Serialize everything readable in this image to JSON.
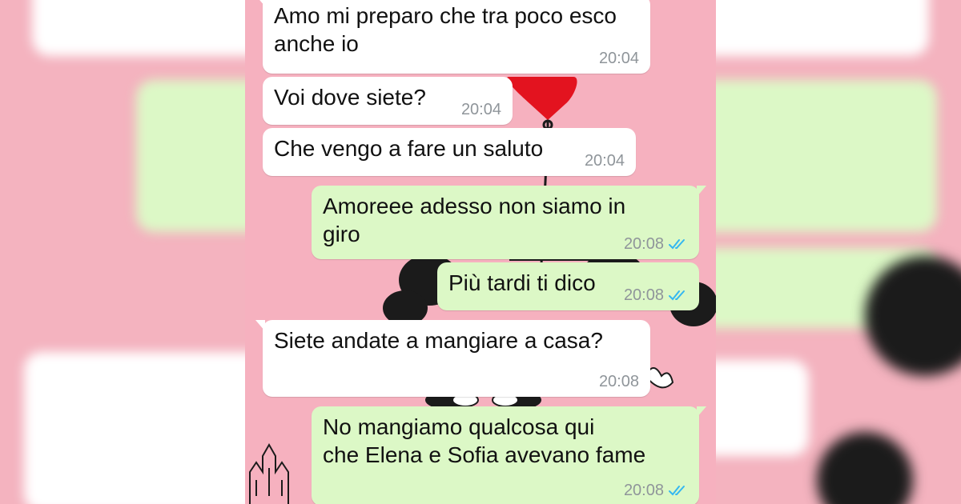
{
  "conversation": {
    "messages": [
      {
        "direction": "incoming",
        "text": "Amo mi preparo che tra poco esco\nanche io",
        "time": "20:04"
      },
      {
        "direction": "incoming",
        "text": "Voi dove siete?",
        "time": "20:04"
      },
      {
        "direction": "incoming",
        "text": "Che vengo a fare un saluto",
        "time": "20:04"
      },
      {
        "direction": "outgoing",
        "text": "Amoreee adesso non siamo in\ngiro",
        "time": "20:08",
        "status": "read"
      },
      {
        "direction": "outgoing",
        "text": "Più tardi ti dico",
        "time": "20:08",
        "status": "read"
      },
      {
        "direction": "incoming",
        "text": "Siete andate a mangiare a casa?",
        "time": "20:08"
      },
      {
        "direction": "outgoing",
        "text": "No mangiamo qualcosa qui\nche Elena e Sofia avevano fame",
        "time": "20:08",
        "status": "read"
      }
    ]
  },
  "colors": {
    "wallpaper": "#f6b1bf",
    "incoming_bubble": "#ffffff",
    "outgoing_bubble": "#dcf8c6",
    "timestamp": "#8f959a",
    "read_ticks": "#34b7f1",
    "heart_balloon": "#e3131f"
  },
  "icons": {
    "read_receipt": "double-check-icon",
    "wallpaper_art": "mickey-minnie-heart-balloon"
  }
}
